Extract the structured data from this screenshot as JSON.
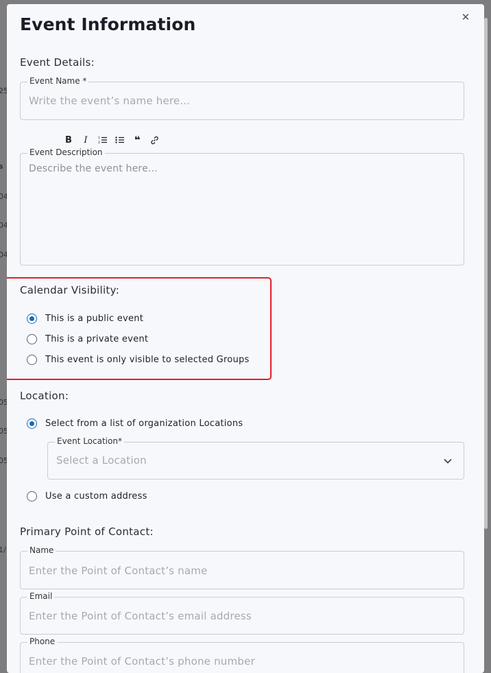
{
  "modal": {
    "title": "Event Information",
    "close_icon": "close-icon",
    "event_details": {
      "section_label": "Event Details:",
      "name_label": "Event Name *",
      "name_placeholder": "Write the event’s name here...",
      "toolbar": [
        "bold-icon",
        "italic-icon",
        "ordered-list-icon",
        "bullet-list-icon",
        "quote-icon",
        "link-icon"
      ],
      "description_label": "Event Description",
      "description_placeholder": "Describe the event here..."
    },
    "calendar_visibility": {
      "section_label": "Calendar Visibility:",
      "options": [
        {
          "label": "This is a public event",
          "checked": true
        },
        {
          "label": "This is a private event",
          "checked": false
        },
        {
          "label": "This event is only visible to selected Groups",
          "checked": false
        }
      ]
    },
    "location": {
      "section_label": "Location:",
      "option_list": {
        "label": "Select from a list of organization Locations",
        "checked": true
      },
      "select_label": "Event Location*",
      "select_placeholder": "Select a Location",
      "option_custom": {
        "label": "Use a custom address",
        "checked": false
      }
    },
    "contact": {
      "section_label": "Primary Point of Contact:",
      "name_label": "Name",
      "name_placeholder": "Enter the Point of Contact’s name",
      "email_label": "Email",
      "email_placeholder": "Enter the Point of Contact’s email address",
      "phone_label": "Phone",
      "phone_placeholder": "Enter the Point of Contact’s phone number"
    }
  },
  "colors": {
    "accent": "#1d68b4",
    "highlight": "#e01f2b",
    "background": "#f7f8fc"
  }
}
